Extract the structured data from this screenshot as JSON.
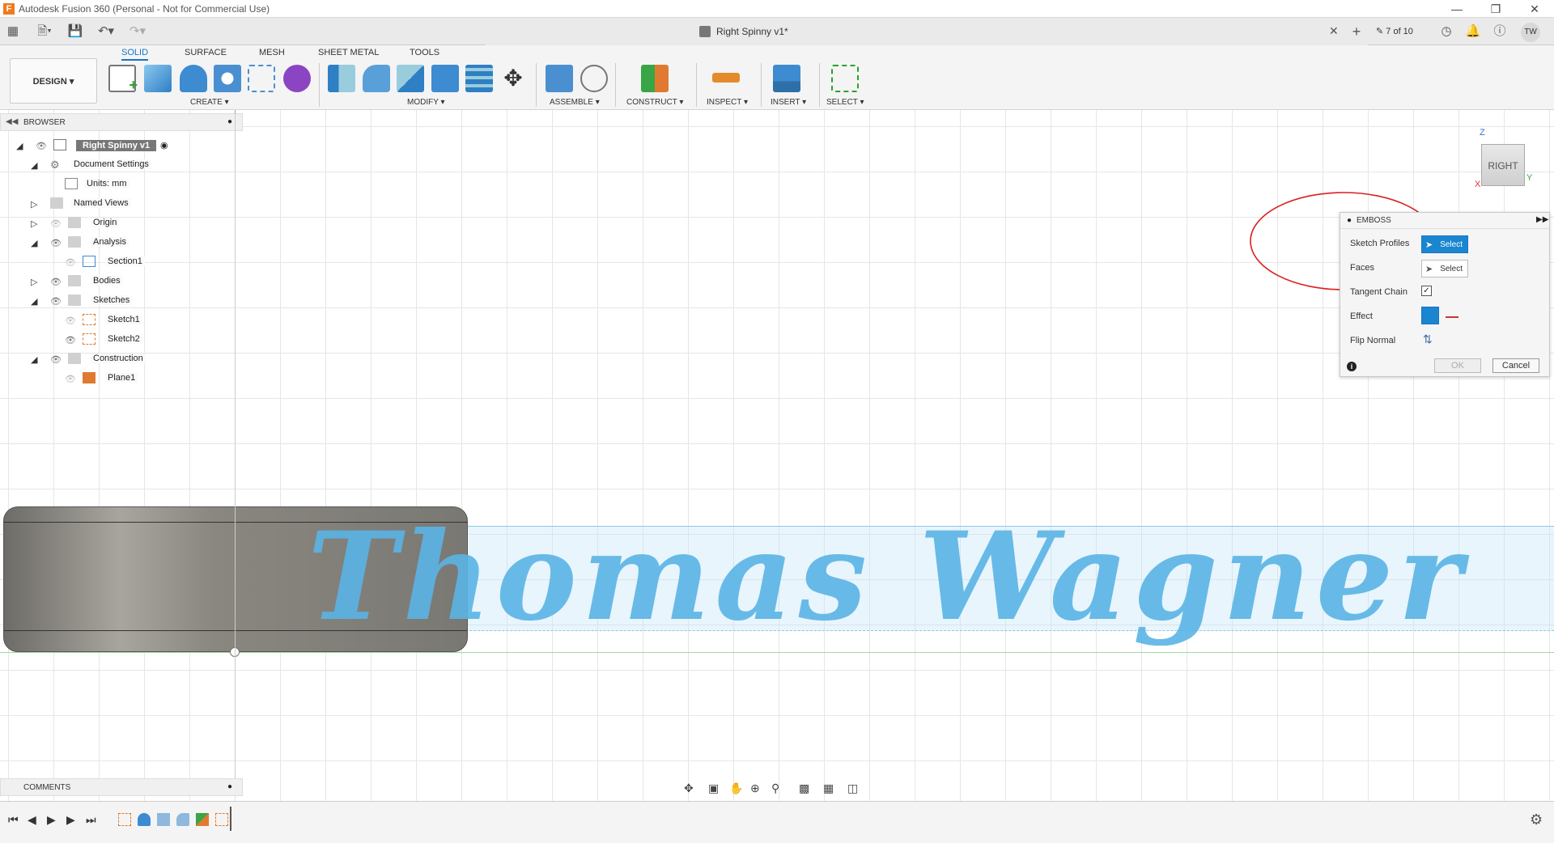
{
  "window": {
    "title": "Autodesk Fusion 360 (Personal - Not for Commercial Use)",
    "logo_letter": "F"
  },
  "tabbar": {
    "doc_title": "Right Spinny v1*",
    "version_badge": "7 of 10",
    "user_initials": "TW"
  },
  "toolbar": {
    "mode_tabs": [
      "SOLID",
      "SURFACE",
      "MESH",
      "SHEET METAL",
      "TOOLS"
    ],
    "workspace": "DESIGN",
    "groups": [
      "CREATE",
      "MODIFY",
      "ASSEMBLE",
      "CONSTRUCT",
      "INSPECT",
      "INSERT",
      "SELECT"
    ]
  },
  "browser": {
    "label": "BROWSER",
    "root": "Right Spinny v1",
    "items": [
      {
        "label": "Document Settings"
      },
      {
        "label": "Units: mm"
      },
      {
        "label": "Named Views"
      },
      {
        "label": "Origin"
      },
      {
        "label": "Analysis"
      },
      {
        "label": "Section1"
      },
      {
        "label": "Bodies"
      },
      {
        "label": "Sketches"
      },
      {
        "label": "Sketch1"
      },
      {
        "label": "Sketch2"
      },
      {
        "label": "Construction"
      },
      {
        "label": "Plane1"
      }
    ]
  },
  "comments": {
    "label": "COMMENTS"
  },
  "viewcube": {
    "face": "RIGHT",
    "axis_z": "Z",
    "axis_y": "Y",
    "axis_x": "X"
  },
  "canvas": {
    "sketch_text": "Thomas Wagner"
  },
  "emboss": {
    "title": "EMBOSS",
    "sketch_profiles_label": "Sketch Profiles",
    "sketch_profiles_button": "Select",
    "faces_label": "Faces",
    "faces_button": "Select",
    "tangent_chain_label": "Tangent Chain",
    "tangent_chain_checked": true,
    "effect_label": "Effect",
    "flip_normal_label": "Flip Normal",
    "ok_label": "OK",
    "cancel_label": "Cancel"
  },
  "colors": {
    "accent": "#1a73c8",
    "sketch_text": "#5ab4e5",
    "annotation": "#d92020",
    "body": "#8a8780"
  }
}
